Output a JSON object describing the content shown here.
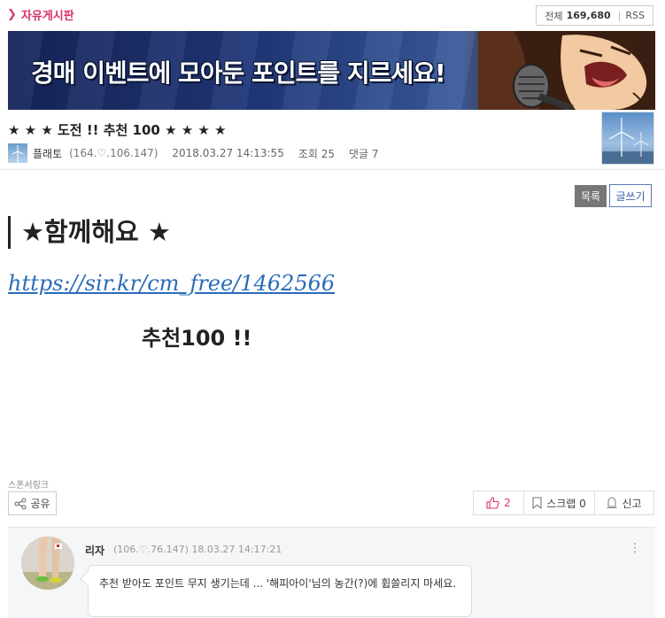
{
  "board": {
    "name": "자유게시판",
    "total_label": "전체",
    "total_count": "169,680",
    "rss_label": "RSS"
  },
  "banner": {
    "text": "경매 이벤트에 모아둔 포인트를 지르세요!"
  },
  "post": {
    "title": "★ ★ ★ 도전 !! 추천 100 ★ ★ ★ ★",
    "author": "플래토",
    "author_ip": "(164.♡.106.147)",
    "date": "2018.03.27 14:13:55",
    "views": "조회 25",
    "comments": "댓글 7"
  },
  "toolbar": {
    "list_label": "목록",
    "write_label": "글쓰기"
  },
  "content": {
    "heading": "★함께해요  ★",
    "link": "https://sir.kr/cm_free/1462566",
    "recommend": "추천100  !!"
  },
  "sponsor_label": "스폰서링크",
  "share_label": "공유",
  "actions": {
    "like_count": "2",
    "scrap_label": "스크랩 0",
    "report_label": "신고"
  },
  "comment": {
    "nick": "리자",
    "ip": "(106.♡.76.147)",
    "datetime": "18.03.27 14:17:21",
    "text": "추천 받아도 포인트 무지 생기는데 ... '해피아이'님의 농간(?)에 휩쓸리지 마세요."
  },
  "colors": {
    "accent": "#d6336c",
    "link": "#2a6cb8",
    "write_border": "#5b7ab8"
  }
}
